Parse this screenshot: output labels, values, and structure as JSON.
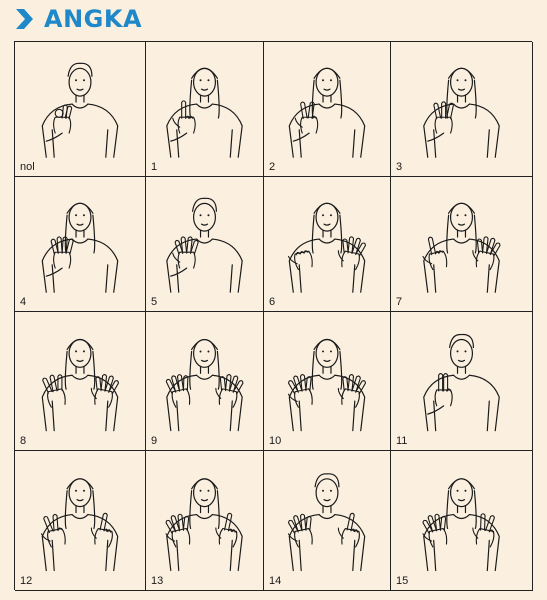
{
  "header": {
    "title": "ANGKA",
    "icon": "chevron-right-icon",
    "accent_color": "#1e88c9"
  },
  "signs": [
    {
      "label": "nol",
      "person": "man",
      "hands": [
        "ok-circle"
      ]
    },
    {
      "label": "1",
      "person": "woman",
      "hands": [
        "index-up"
      ]
    },
    {
      "label": "2",
      "person": "woman",
      "hands": [
        "two-fingers"
      ]
    },
    {
      "label": "3",
      "person": "woman",
      "hands": [
        "three-fingers"
      ]
    },
    {
      "label": "4",
      "person": "woman",
      "hands": [
        "four-fingers"
      ]
    },
    {
      "label": "5",
      "person": "man",
      "hands": [
        "open-palm"
      ]
    },
    {
      "label": "6",
      "person": "woman",
      "hands": [
        "thumb-side",
        "open-palm"
      ]
    },
    {
      "label": "7",
      "person": "woman",
      "hands": [
        "index-up",
        "open-palm"
      ]
    },
    {
      "label": "8",
      "person": "woman",
      "hands": [
        "three-fingers",
        "open-palm"
      ]
    },
    {
      "label": "9",
      "person": "woman",
      "hands": [
        "four-fingers",
        "open-palm"
      ]
    },
    {
      "label": "10",
      "person": "woman",
      "hands": [
        "open-palm",
        "open-palm"
      ]
    },
    {
      "label": "11",
      "person": "man",
      "hands": [
        "two-index-up"
      ]
    },
    {
      "label": "12",
      "person": "woman",
      "hands": [
        "two-fingers",
        "index-up"
      ]
    },
    {
      "label": "13",
      "person": "woman",
      "hands": [
        "open-palm",
        "index-up"
      ]
    },
    {
      "label": "14",
      "person": "man",
      "hands": [
        "open-palm",
        "index-up"
      ]
    },
    {
      "label": "15",
      "person": "woman",
      "hands": [
        "open-palm",
        "two-fingers"
      ]
    }
  ]
}
